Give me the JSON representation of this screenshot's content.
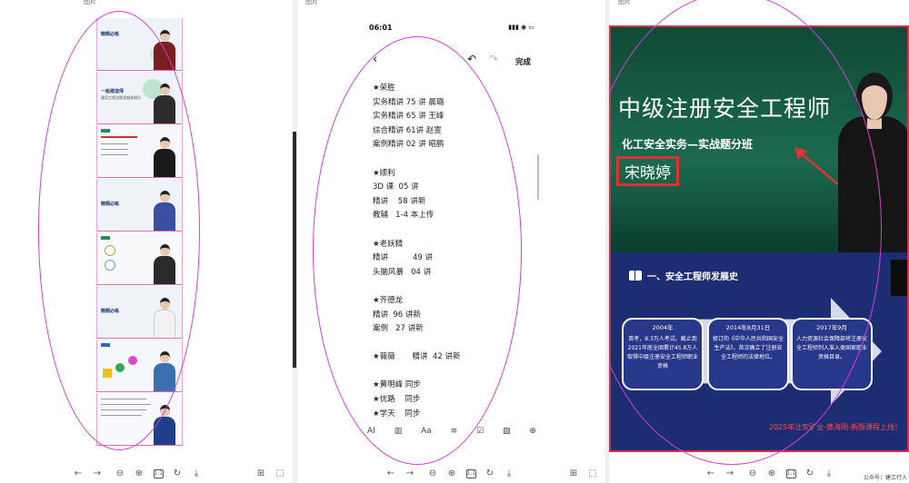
{
  "pane_labels": [
    "图片",
    "图片",
    "图片"
  ],
  "pane1": {
    "slides": [
      {
        "title": "精题必练",
        "subtitle": "",
        "body_color": "#7a1f1f"
      },
      {
        "title": "一级建造师",
        "subtitle": "建设工程法规及相关知识",
        "body_color": "#2c2c2c"
      },
      {
        "title": "",
        "subtitle": "",
        "body_color": "#1a1a1a"
      },
      {
        "title": "精题必练",
        "subtitle": "",
        "body_color": "#3b4fa0"
      },
      {
        "title": "",
        "subtitle": "",
        "body_color": "#2a2a2a"
      },
      {
        "title": "精题必练",
        "subtitle": "",
        "body_color": "#f2f2f2"
      },
      {
        "title": "",
        "subtitle": "",
        "body_color": "#3a6fb0"
      },
      {
        "title": "",
        "subtitle": "",
        "body_color": "#1f3f8a"
      }
    ]
  },
  "toolbar_icons": [
    "prev-arrow-icon",
    "next-arrow-icon",
    "zoom-out-icon",
    "zoom-in-icon",
    "fit-page-icon",
    "rotate-icon",
    "download-icon",
    "grid-icon",
    "crop-icon"
  ],
  "toolbar_glyphs": {
    "prev": "←",
    "next": "→",
    "zoom_out": "⊖",
    "zoom_in": "⊕",
    "fit": "1:1",
    "rotate": "↻",
    "download": "⤓",
    "grid": "⊞",
    "crop": "⬚"
  },
  "phone": {
    "time": "06:01",
    "status_icons": "▮▮▮ ◉ ▭",
    "done_label": "完成",
    "back_glyph": "‹",
    "undo_glyph": "↶",
    "redo_glyph": "↷",
    "lines": [
      "★荣胜",
      "实务精讲 75 讲 晨璐",
      "实务精讲 65 讲 王峰",
      "综合精讲 61讲 赵雯",
      "案例精讲 02 讲 昭鹏",
      "",
      "★顺利",
      "3D 课  05 讲",
      "精讲    58 讲新",
      "教辅   1-4 本上传",
      "",
      "★老妖精",
      "精讲          49 讲",
      "头脑风暴   04 讲",
      "",
      "★齐德龙",
      "精讲  96 讲新",
      "案例   27 讲新",
      "",
      "★薇薇       精讲  42 讲新",
      "",
      "★黄明峰 同步",
      "★优路    同步",
      "★学天    同步"
    ],
    "tools": [
      "AI",
      "▥",
      "Aa",
      "≡",
      "☑",
      "▨",
      "⊕"
    ]
  },
  "video": {
    "title": "中级注册安全工程师",
    "subtitle": "化工安全实务—实战题分班",
    "name": "宋晓婷",
    "section_header": "一、安全工程师发展史",
    "cards": [
      {
        "year": "2004年",
        "text": "首考，8.3万人考试。截止到2021年底全国累计45.8万人取得中级注册安全工程师职业资格"
      },
      {
        "year": "2014年8月31日",
        "text": "修订的《中华人民共和国安全生产法》，首次确立了注册安全工程师的法律地位。"
      },
      {
        "year": "2017年9月",
        "text": "人力资源社会保障部将注册安全工程师列入准入类国家职业资格目录。"
      }
    ],
    "footer": "2025年注安矿业-黄海刚-新版课程上线！",
    "watermark": "公众号：建工行人"
  },
  "colors": {
    "oval": "#d63cd8",
    "video_border": "#d9304a",
    "green_bg": "#1a5b45",
    "blue_bg": "#1d2d72",
    "footer_red": "#ff4a4a"
  }
}
